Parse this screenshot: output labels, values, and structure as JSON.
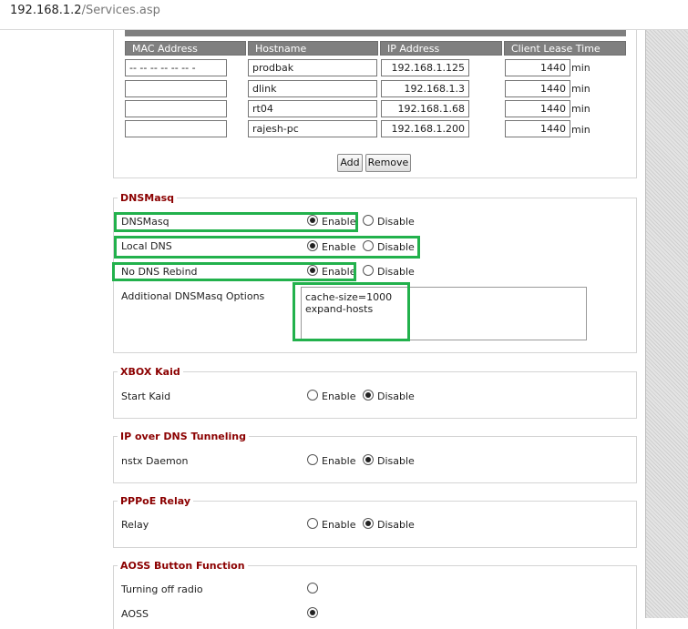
{
  "browser": {
    "host": "192.168.1.2",
    "path": "/Services.asp"
  },
  "static_leases": {
    "headers": [
      "MAC Address",
      "Hostname",
      "IP Address",
      "Client Lease Time"
    ],
    "rows": [
      {
        "mac": "-- -- -- -- -- -- -",
        "hostname": "prodbak",
        "ip": "192.168.1.125",
        "lease": "1440",
        "unit": "min"
      },
      {
        "mac": "",
        "hostname": "dlink",
        "ip": "192.168.1.3",
        "lease": "1440",
        "unit": "min"
      },
      {
        "mac": "",
        "hostname": "rt04",
        "ip": "192.168.1.68",
        "lease": "1440",
        "unit": "min"
      },
      {
        "mac": "",
        "hostname": "rajesh-pc",
        "ip": "192.168.1.200",
        "lease": "1440",
        "unit": "min"
      }
    ],
    "add_label": "Add",
    "remove_label": "Remove"
  },
  "dnsmasq": {
    "legend": "DNSMasq",
    "rows": [
      {
        "label": "DNSMasq",
        "enabled": true
      },
      {
        "label": "Local DNS",
        "enabled": true
      },
      {
        "label": "No DNS Rebind",
        "enabled": true
      }
    ],
    "options_label": "Additional DNSMasq Options",
    "options_value": "cache-size=1000\nexpand-hosts"
  },
  "xbox": {
    "legend": "XBOX Kaid",
    "label": "Start Kaid",
    "enabled": false
  },
  "dns_tunnel": {
    "legend": "IP over DNS Tunneling",
    "label": "nstx Daemon",
    "enabled": false
  },
  "pppoe_relay": {
    "legend": "PPPoE Relay",
    "label": "Relay",
    "enabled": false
  },
  "aoss": {
    "legend": "AOSS Button Function",
    "rows": [
      {
        "label": "Turning off radio",
        "checked": false
      },
      {
        "label": "AOSS",
        "checked": true
      }
    ]
  },
  "radio_labels": {
    "enable": "Enable",
    "disable": "Disable"
  },
  "highlight_color": "#22b14c"
}
